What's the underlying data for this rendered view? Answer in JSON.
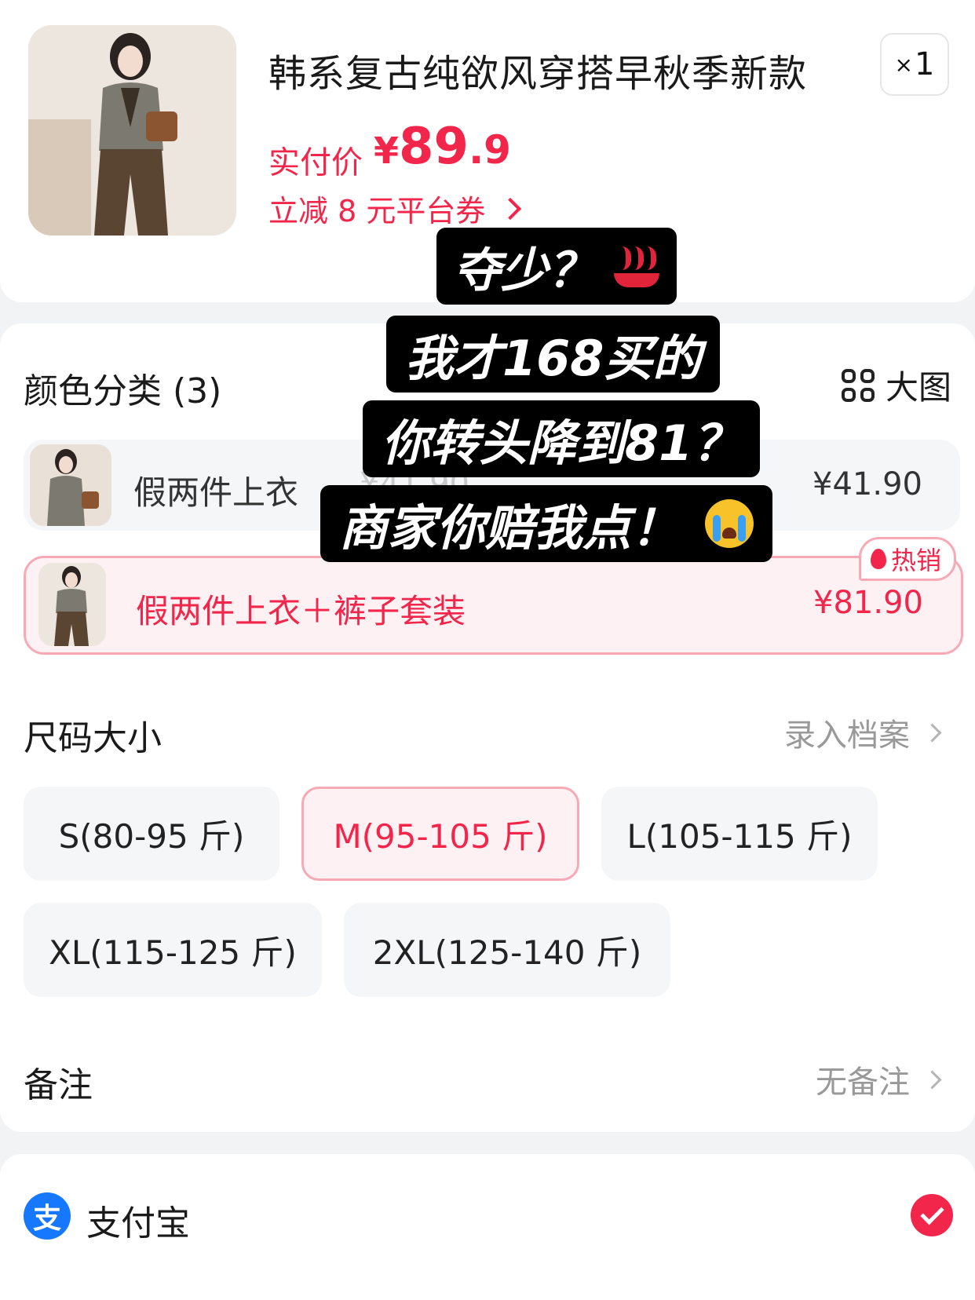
{
  "product": {
    "title": "韩系复古纯欲风穿搭早秋季新款",
    "qty_prefix": "×",
    "qty": "1",
    "price_label": "实付价",
    "price_currency": "¥",
    "price_int": "89",
    "price_dec": ".9",
    "coupon_text": "立减 8 元平台券"
  },
  "color_section": {
    "title": "颜色分类 (3)",
    "view_big_label": "大图",
    "options": [
      {
        "name": "假两件上衣",
        "price": "¥41.90",
        "ghost_text": "¥41.90"
      },
      {
        "name": "假两件上衣＋裤子套装",
        "price": "¥81.90",
        "badge": "热销"
      }
    ]
  },
  "size_section": {
    "title": "尺码大小",
    "right_link": "录入档案",
    "sizes": [
      {
        "label": "S(80-95 斤)",
        "selected": false
      },
      {
        "label": "M(95-105 斤)",
        "selected": true
      },
      {
        "label": "L(105-115 斤)",
        "selected": false
      },
      {
        "label": "XL(115-125 斤)",
        "selected": false
      },
      {
        "label": "2XL(125-140 斤)",
        "selected": false
      }
    ]
  },
  "remark": {
    "title": "备注",
    "value": "无备注"
  },
  "payment": {
    "icon_text": "支",
    "method": "支付宝",
    "selected": true
  },
  "overlay_caption": {
    "line1": "夺少？",
    "line2": "我才168买的",
    "line3": "你转头降到81？",
    "line4": "商家你赔我点！"
  },
  "colors": {
    "accent": "#f2264a",
    "accent_bg": "#fdf1f3",
    "accent_border": "#f7a9b6",
    "alipay_blue": "#1677ff",
    "page_bg": "#f2f3f5"
  }
}
